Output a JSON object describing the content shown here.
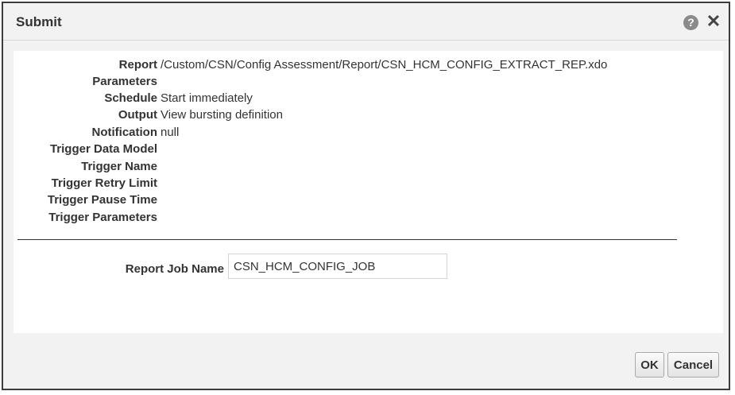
{
  "dialog": {
    "title": "Submit",
    "help_icon": "question-circle-icon",
    "close_icon": "close-icon",
    "close_glyph": "✕",
    "help_glyph": "?"
  },
  "details": [
    {
      "label": "Report",
      "value": "/Custom/CSN/Config Assessment/Report/CSN_HCM_CONFIG_EXTRACT_REP.xdo"
    },
    {
      "label": "Parameters",
      "value": ""
    },
    {
      "label": "Schedule",
      "value": "Start immediately"
    },
    {
      "label": "Output",
      "value": "View bursting definition"
    },
    {
      "label": "Notification",
      "value": "null"
    },
    {
      "label": "Trigger Data Model",
      "value": ""
    },
    {
      "label": "Trigger Name",
      "value": ""
    },
    {
      "label": "Trigger Retry Limit",
      "value": ""
    },
    {
      "label": "Trigger Pause Time",
      "value": ""
    },
    {
      "label": "Trigger Parameters",
      "value": ""
    }
  ],
  "job": {
    "label": "Report Job Name",
    "value": "CSN_HCM_CONFIG_JOB"
  },
  "buttons": {
    "ok": "OK",
    "cancel": "Cancel"
  }
}
